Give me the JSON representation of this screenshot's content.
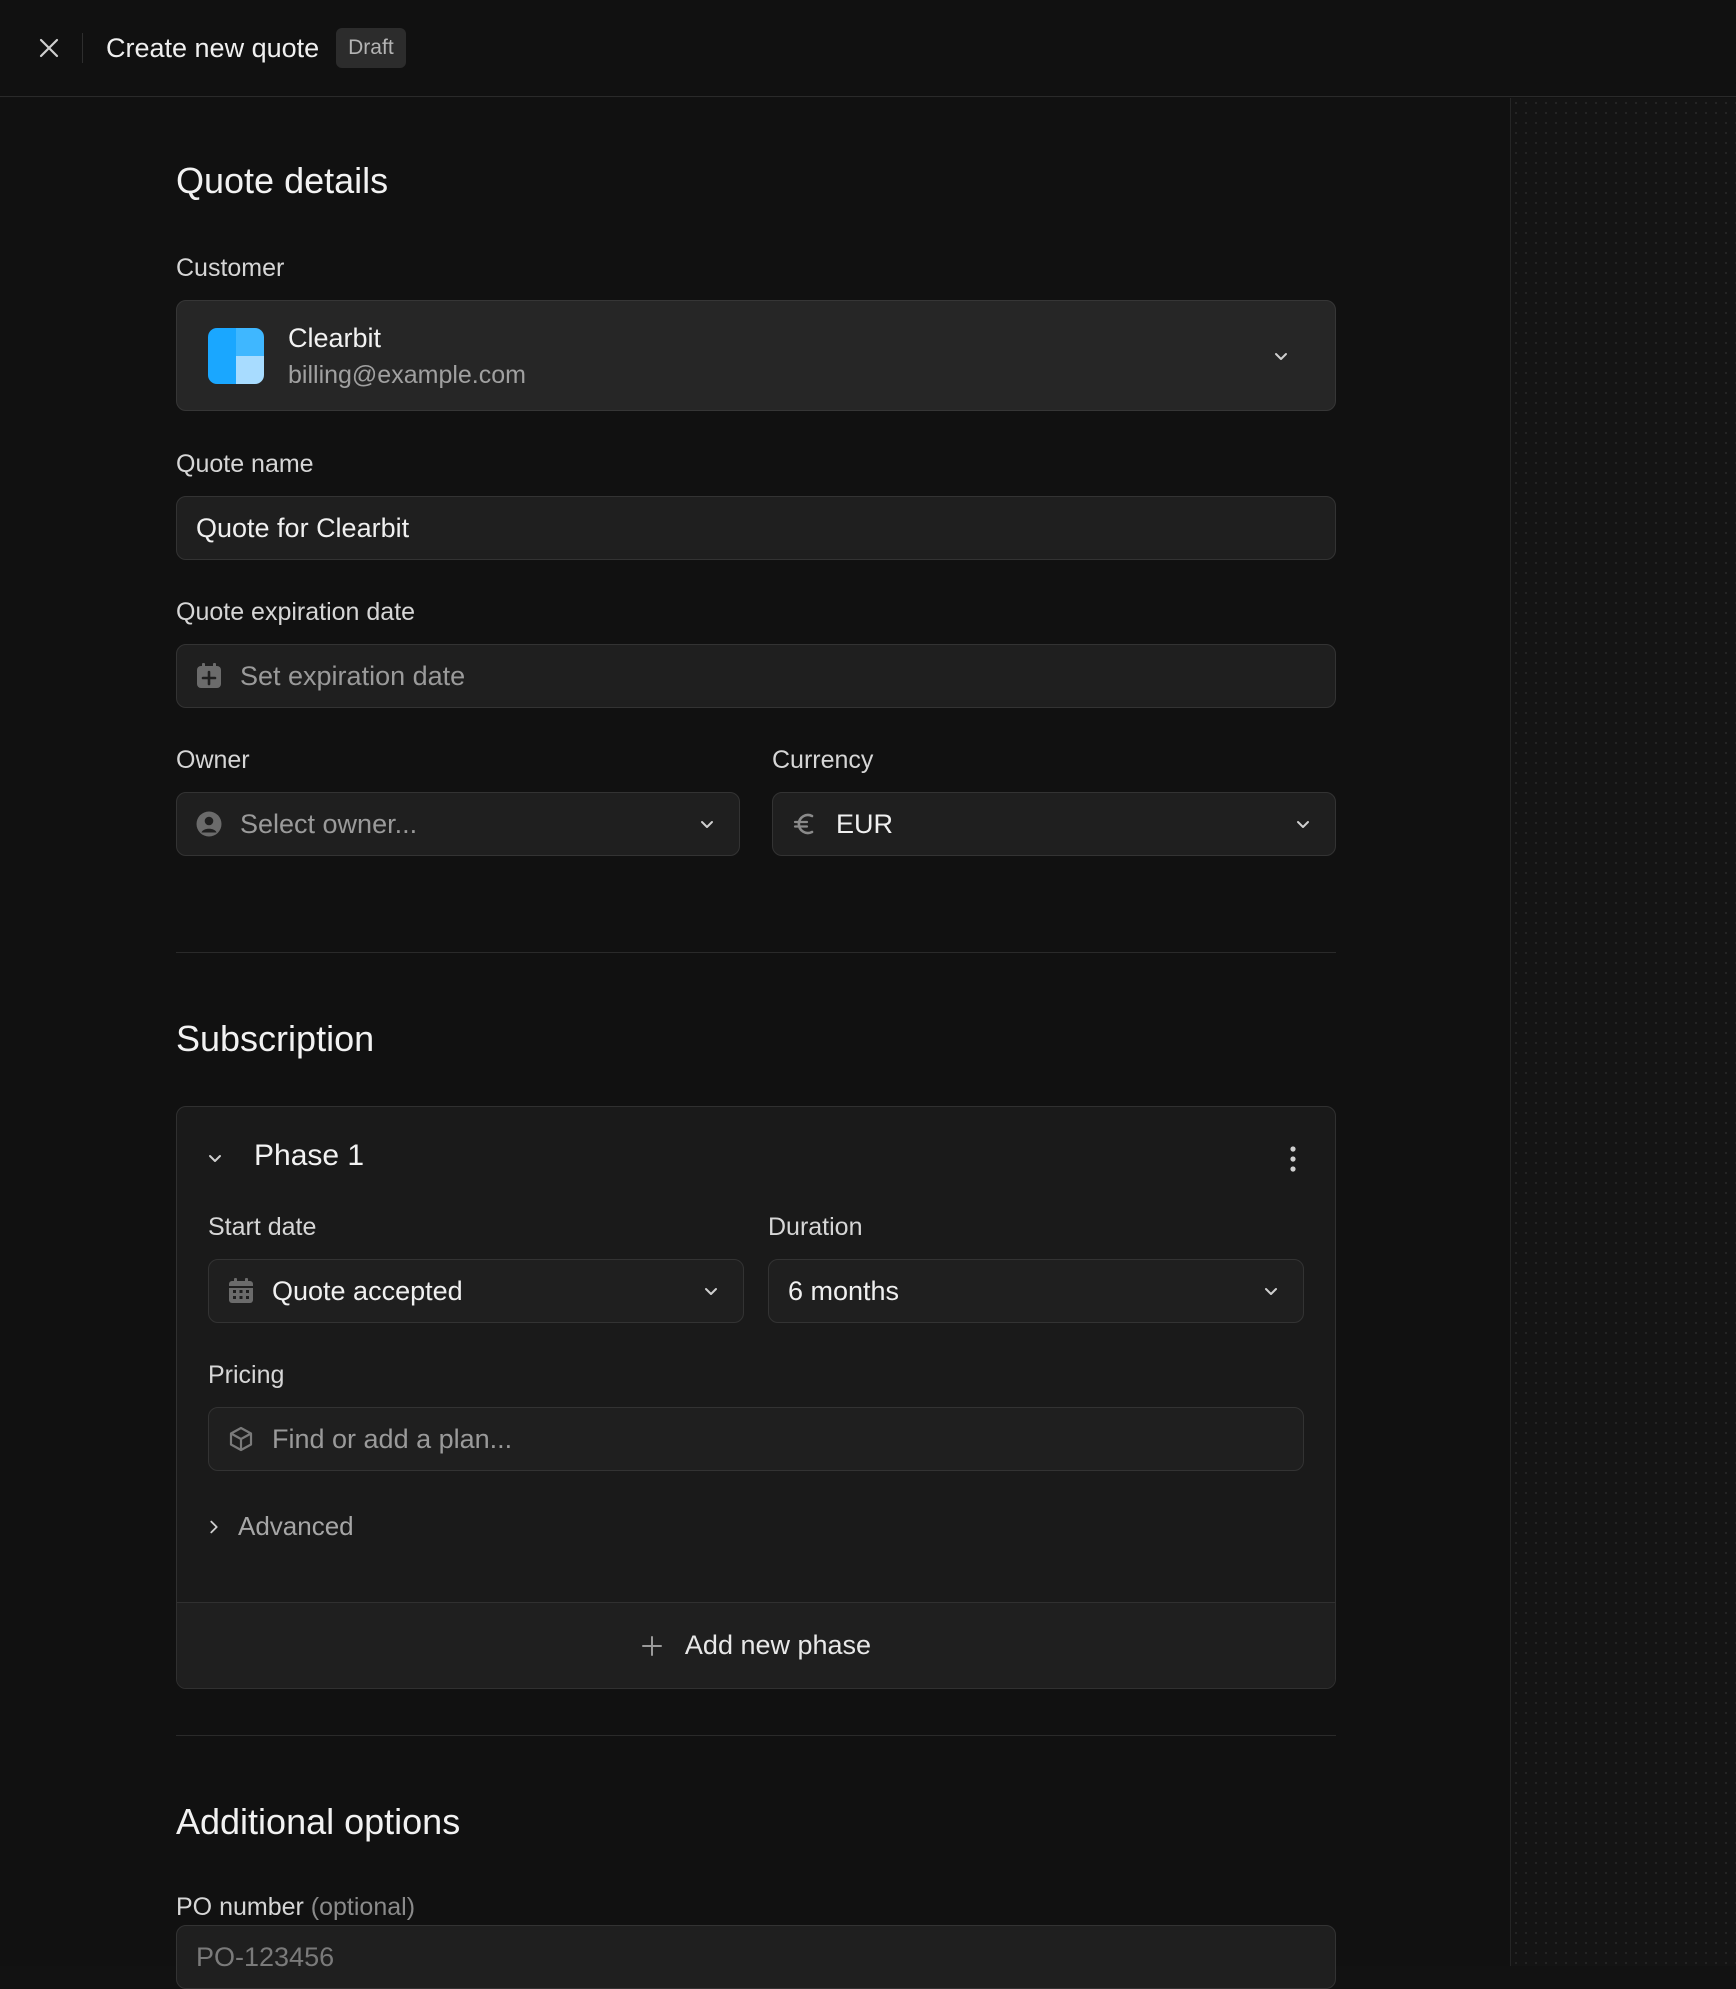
{
  "header": {
    "title": "Create new quote",
    "badge": "Draft"
  },
  "quote_details": {
    "section_title": "Quote details",
    "customer": {
      "label": "Customer",
      "name": "Clearbit",
      "email": "billing@example.com"
    },
    "quote_name": {
      "label": "Quote name",
      "value": "Quote for Clearbit"
    },
    "expiration": {
      "label": "Quote expiration date",
      "placeholder": "Set expiration date"
    },
    "owner": {
      "label": "Owner",
      "placeholder": "Select owner..."
    },
    "currency": {
      "label": "Currency",
      "value": "EUR"
    }
  },
  "subscription": {
    "section_title": "Subscription",
    "phase": {
      "title": "Phase 1",
      "start_date": {
        "label": "Start date",
        "value": "Quote accepted"
      },
      "duration": {
        "label": "Duration",
        "value": "6 months"
      },
      "pricing": {
        "label": "Pricing",
        "placeholder": "Find or add a plan..."
      },
      "advanced_label": "Advanced"
    },
    "add_phase_label": "Add new phase"
  },
  "additional_options": {
    "section_title": "Additional options",
    "po_number": {
      "label": "PO number",
      "optional": "(optional)",
      "placeholder": "PO-123456"
    }
  },
  "colors": {
    "background": "#111111",
    "field": "#1f1f1f",
    "logo_primary": "#1aa7ff",
    "logo_light": "#a8dcff"
  }
}
